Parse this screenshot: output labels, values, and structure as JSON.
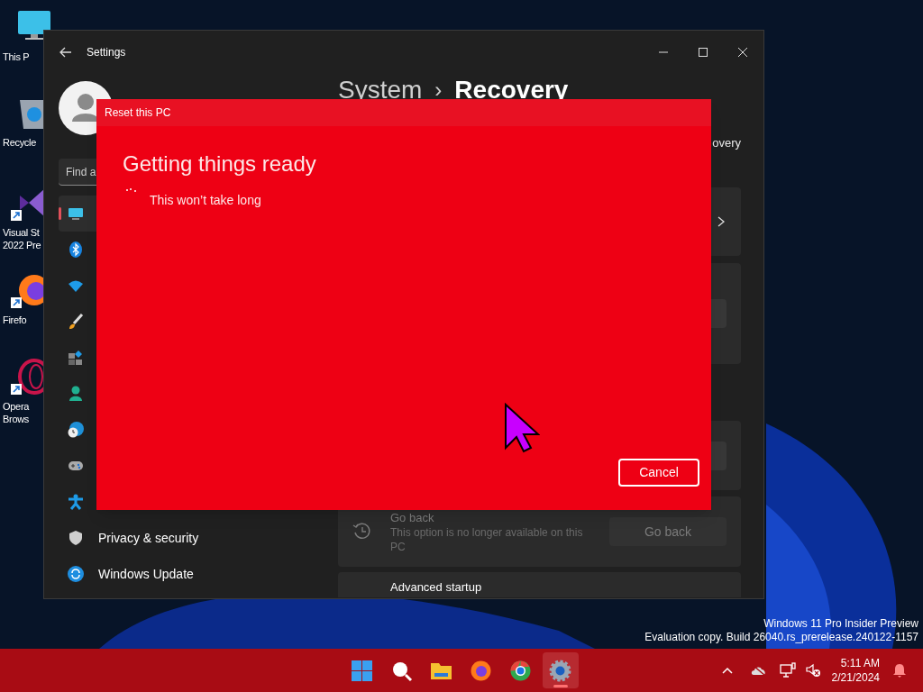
{
  "desktop_icons": [
    {
      "kind": "monitor",
      "lines": [
        "This P"
      ],
      "shortcut": false
    },
    {
      "kind": "recycle",
      "lines": [
        "Recycle"
      ],
      "shortcut": false
    },
    {
      "kind": "studio",
      "lines": [
        "Visual St",
        "2022 Pre"
      ],
      "shortcut": true
    },
    {
      "kind": "firefox",
      "lines": [
        "Firefo"
      ],
      "shortcut": true
    },
    {
      "kind": "opera",
      "lines": [
        "Opera",
        "Brows"
      ],
      "shortcut": true
    }
  ],
  "settings_window": {
    "title": "Settings",
    "search": {
      "placeholder": "Find a"
    },
    "nav_items": [
      {
        "kind": "display",
        "selected": true
      },
      {
        "kind": "bluetooth",
        "selected": false
      },
      {
        "kind": "wifi",
        "selected": false
      },
      {
        "kind": "brush",
        "selected": false
      },
      {
        "kind": "apps",
        "selected": false
      },
      {
        "kind": "person",
        "selected": false
      },
      {
        "kind": "time",
        "selected": false
      },
      {
        "kind": "gaming",
        "selected": false
      },
      {
        "kind": "accessibility",
        "selected": false
      },
      {
        "kind": "privacy",
        "label": "Privacy & security",
        "selected": false
      },
      {
        "kind": "update",
        "label": "Windows Update",
        "selected": false
      }
    ],
    "breadcrumb": {
      "parent": "System",
      "separator": "›",
      "current": "Recovery"
    },
    "intro_fragment": "overy",
    "go_back": {
      "title": "Go back",
      "description": "This option is no longer available on this PC",
      "button": "Go back",
      "disabled": true
    },
    "advanced_startup": {
      "title": "Advanced startup"
    }
  },
  "dialog": {
    "title": "Reset this PC",
    "heading": "Getting things ready",
    "status": "This won’t take long",
    "button": "Cancel"
  },
  "watermark": [
    "Windows 11 Pro Insider Preview",
    "Evaluation copy. Build 26040.rs_prerelease.240122-1157"
  ],
  "taskbar": {
    "apps": [
      {
        "kind": "start",
        "active": false
      },
      {
        "kind": "search",
        "active": false
      },
      {
        "kind": "explorer",
        "active": false
      },
      {
        "kind": "firefox",
        "active": false
      },
      {
        "kind": "chrome",
        "active": false
      },
      {
        "kind": "settings",
        "active": true
      }
    ],
    "time": "5:11 AM",
    "date": "2/21/2024"
  }
}
